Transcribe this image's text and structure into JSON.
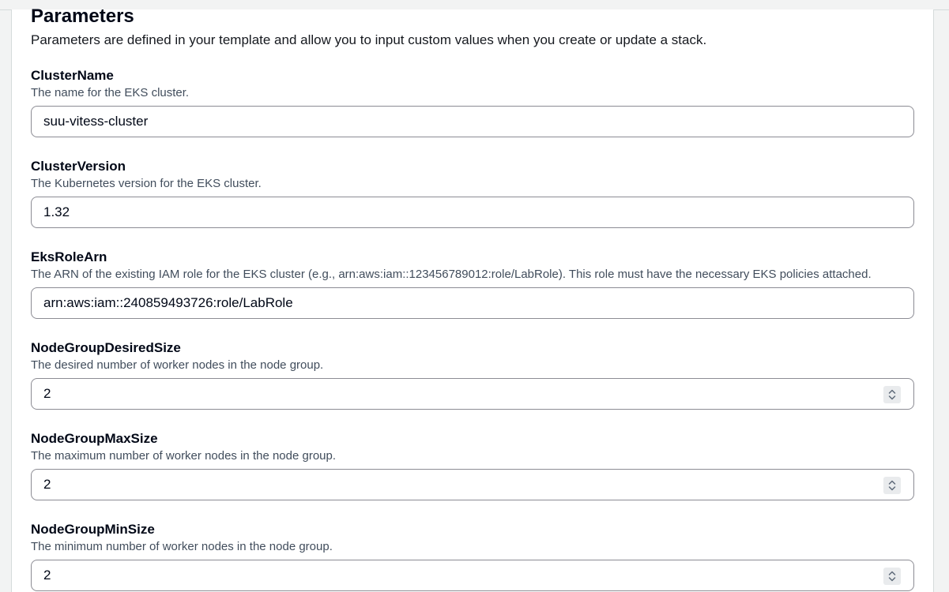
{
  "section": {
    "title": "Parameters",
    "description": "Parameters are defined in your template and allow you to input custom values when you create or update a stack."
  },
  "parameters": [
    {
      "label": "ClusterName",
      "description": "The name for the EKS cluster.",
      "value": "suu-vitess-cluster",
      "type": "text"
    },
    {
      "label": "ClusterVersion",
      "description": "The Kubernetes version for the EKS cluster.",
      "value": "1.32",
      "type": "text"
    },
    {
      "label": "EksRoleArn",
      "description": "The ARN of the existing IAM role for the EKS cluster (e.g., arn:aws:iam::123456789012:role/LabRole). This role must have the necessary EKS policies attached.",
      "value": "arn:aws:iam::240859493726:role/LabRole",
      "type": "text"
    },
    {
      "label": "NodeGroupDesiredSize",
      "description": "The desired number of worker nodes in the node group.",
      "value": "2",
      "type": "number"
    },
    {
      "label": "NodeGroupMaxSize",
      "description": "The maximum number of worker nodes in the node group.",
      "value": "2",
      "type": "number"
    },
    {
      "label": "NodeGroupMinSize",
      "description": "The minimum number of worker nodes in the node group.",
      "value": "2",
      "type": "number"
    }
  ],
  "icons": {
    "stepper": "up-down-chevron-icon"
  },
  "colors": {
    "input_border": "#8c8c94",
    "label_text": "#000716",
    "description_text": "#414d5c",
    "panel_background": "#ffffff",
    "page_background": "#f2f3f3"
  }
}
